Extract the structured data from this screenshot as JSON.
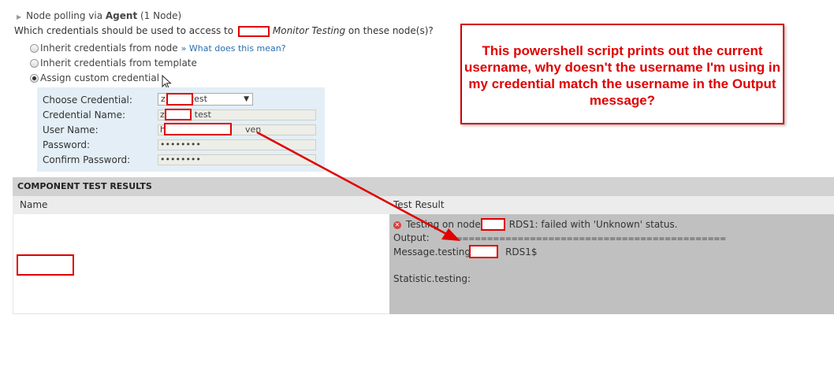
{
  "polling": {
    "prefix": "Node polling via ",
    "method": "Agent",
    "suffix": " (1 Node)"
  },
  "question": {
    "prefix": "Which credentials should be used to access to ",
    "app_name": "Monitor Testing",
    "suffix": " on these node(s)?"
  },
  "radios": {
    "inherit_node": "Inherit credentials from node",
    "what_link": "» What does this mean?",
    "inherit_template": "Inherit credentials from template",
    "custom": "Assign custom credential"
  },
  "credential_form": {
    "choose_label": "Choose Credential:",
    "choose_value_a": "z",
    "choose_value_b": "test",
    "name_label": "Credential Name:",
    "name_value_a": "z",
    "name_value_b": "test",
    "user_label": "User Name:",
    "user_value_a": "h",
    "user_value_b": "ven",
    "password_label": "Password:",
    "password_value": "••••••••",
    "confirm_label": "Confirm Password:",
    "confirm_value": "••••••••"
  },
  "results": {
    "header": "COMPONENT TEST RESULTS",
    "col_name": "Name",
    "col_result": "Test Result",
    "line1_a": "Testing on node",
    "line1_b": "RDS1: failed with 'Unknown' status.",
    "output_label": "Output:",
    "output_value": "=============================================",
    "message_label": "Message.testing:",
    "message_value": "RDS1$",
    "statistic_label": "Statistic.testing:"
  },
  "callout_text": "This powershell script prints out the current username, why doesn't the username I'm using in my credential match the username in the Output message?",
  "colors": {
    "annotation_red": "#e00000",
    "panel_blue": "#e3eef6",
    "result_gray": "#c0c0c0",
    "header_gray": "#d2d2d2"
  }
}
